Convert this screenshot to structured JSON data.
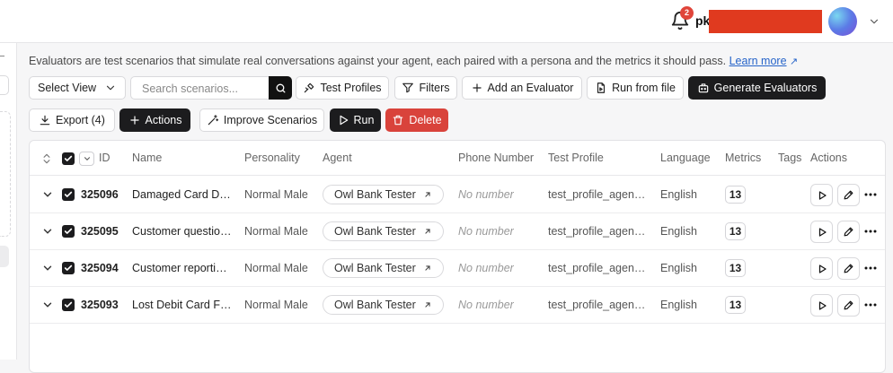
{
  "topbar": {
    "notification_count": "2",
    "user_prefix": "pk"
  },
  "description": {
    "text": "Evaluators are test scenarios that simulate real conversations against your agent, each paired with a persona and the metrics it should pass.",
    "link": "Learn more",
    "link_arrow": "↗"
  },
  "toolbar": {
    "select_view": "Select View",
    "search_placeholder": "Search scenarios...",
    "test_profiles": "Test Profiles",
    "filters": "Filters",
    "add_evaluator": "Add an Evaluator",
    "run_from_file": "Run from file",
    "generate": "Generate Evaluators",
    "export": "Export (4)",
    "actions": "Actions",
    "improve": "Improve Scenarios",
    "run": "Run",
    "delete": "Delete"
  },
  "table": {
    "columns": {
      "id": "ID",
      "name": "Name",
      "personality": "Personality",
      "agent": "Agent",
      "phone": "Phone Number",
      "profile": "Test Profile",
      "language": "Language",
      "metrics": "Metrics",
      "tags": "Tags",
      "actions": "Actions"
    },
    "rows": [
      {
        "id": "325096",
        "name": "Damaged Card D…",
        "personality": "Normal Male",
        "agent": "Owl Bank Tester",
        "phone": "No number",
        "profile": "test_profile_agen…",
        "language": "English",
        "metrics": "13"
      },
      {
        "id": "325095",
        "name": "Customer questio…",
        "personality": "Normal Male",
        "agent": "Owl Bank Tester",
        "phone": "No number",
        "profile": "test_profile_agen…",
        "language": "English",
        "metrics": "13"
      },
      {
        "id": "325094",
        "name": "Customer reporti…",
        "personality": "Normal Male",
        "agent": "Owl Bank Tester",
        "phone": "No number",
        "profile": "test_profile_agen…",
        "language": "English",
        "metrics": "13"
      },
      {
        "id": "325093",
        "name": "Lost Debit Card F…",
        "personality": "Normal Male",
        "agent": "Owl Bank Tester",
        "phone": "No number",
        "profile": "test_profile_agen…",
        "language": "English",
        "metrics": "13"
      }
    ]
  },
  "icons": [
    "bell-icon",
    "chevron-down-icon",
    "search-icon",
    "test-profiles-icon",
    "filter-icon",
    "plus-icon",
    "file-icon",
    "generate-icon",
    "download-icon",
    "wand-icon",
    "play-icon",
    "trash-icon",
    "sort-icon",
    "checkbox-icon",
    "external-link-icon",
    "pencil-icon",
    "more-icon"
  ],
  "colors": {
    "accent_dark": "#1c1c1e",
    "danger": "#d9433b",
    "link": "#2563c9",
    "badge": "#e0453a",
    "redaction": "#e03a1f"
  }
}
